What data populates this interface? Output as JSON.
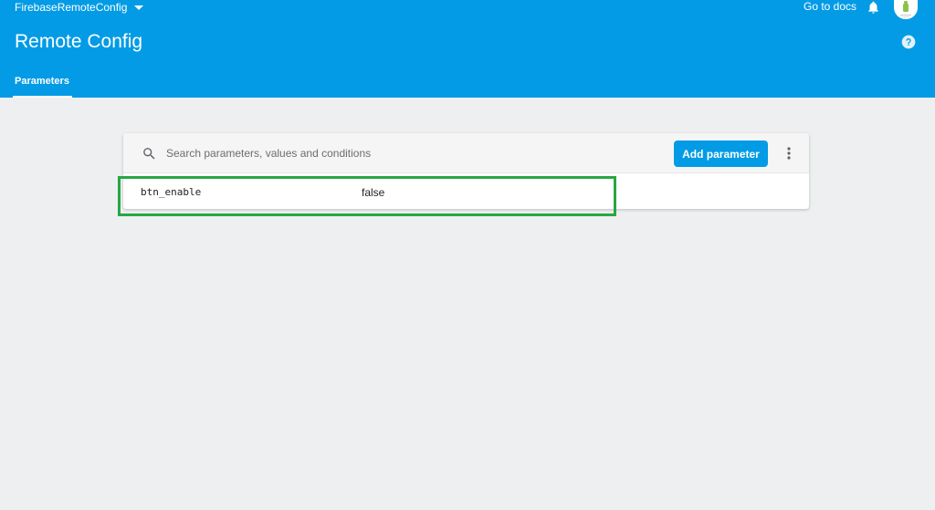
{
  "header": {
    "project_name": "FirebaseRemoteConfig",
    "docs_link": "Go to docs",
    "page_title": "Remote Config",
    "icons": {
      "project_dropdown": "caret-down-icon",
      "notifications": "bell-icon",
      "help": "help-circle-icon",
      "avatar": "android-robot-avatar"
    }
  },
  "tabs": [
    {
      "label": "Parameters",
      "active": true
    }
  ],
  "toolbar": {
    "search_placeholder": "Search parameters, values and conditions",
    "search_value": "",
    "add_parameter_label": "Add parameter",
    "icons": {
      "search": "search-icon",
      "more": "more-vert-icon"
    }
  },
  "parameters": [
    {
      "key": "btn_enable",
      "value": "false"
    }
  ],
  "colors": {
    "header": "#039be5",
    "page_background": "#eeeff1",
    "primary_button": "#039be5",
    "highlight": "#27a744"
  }
}
